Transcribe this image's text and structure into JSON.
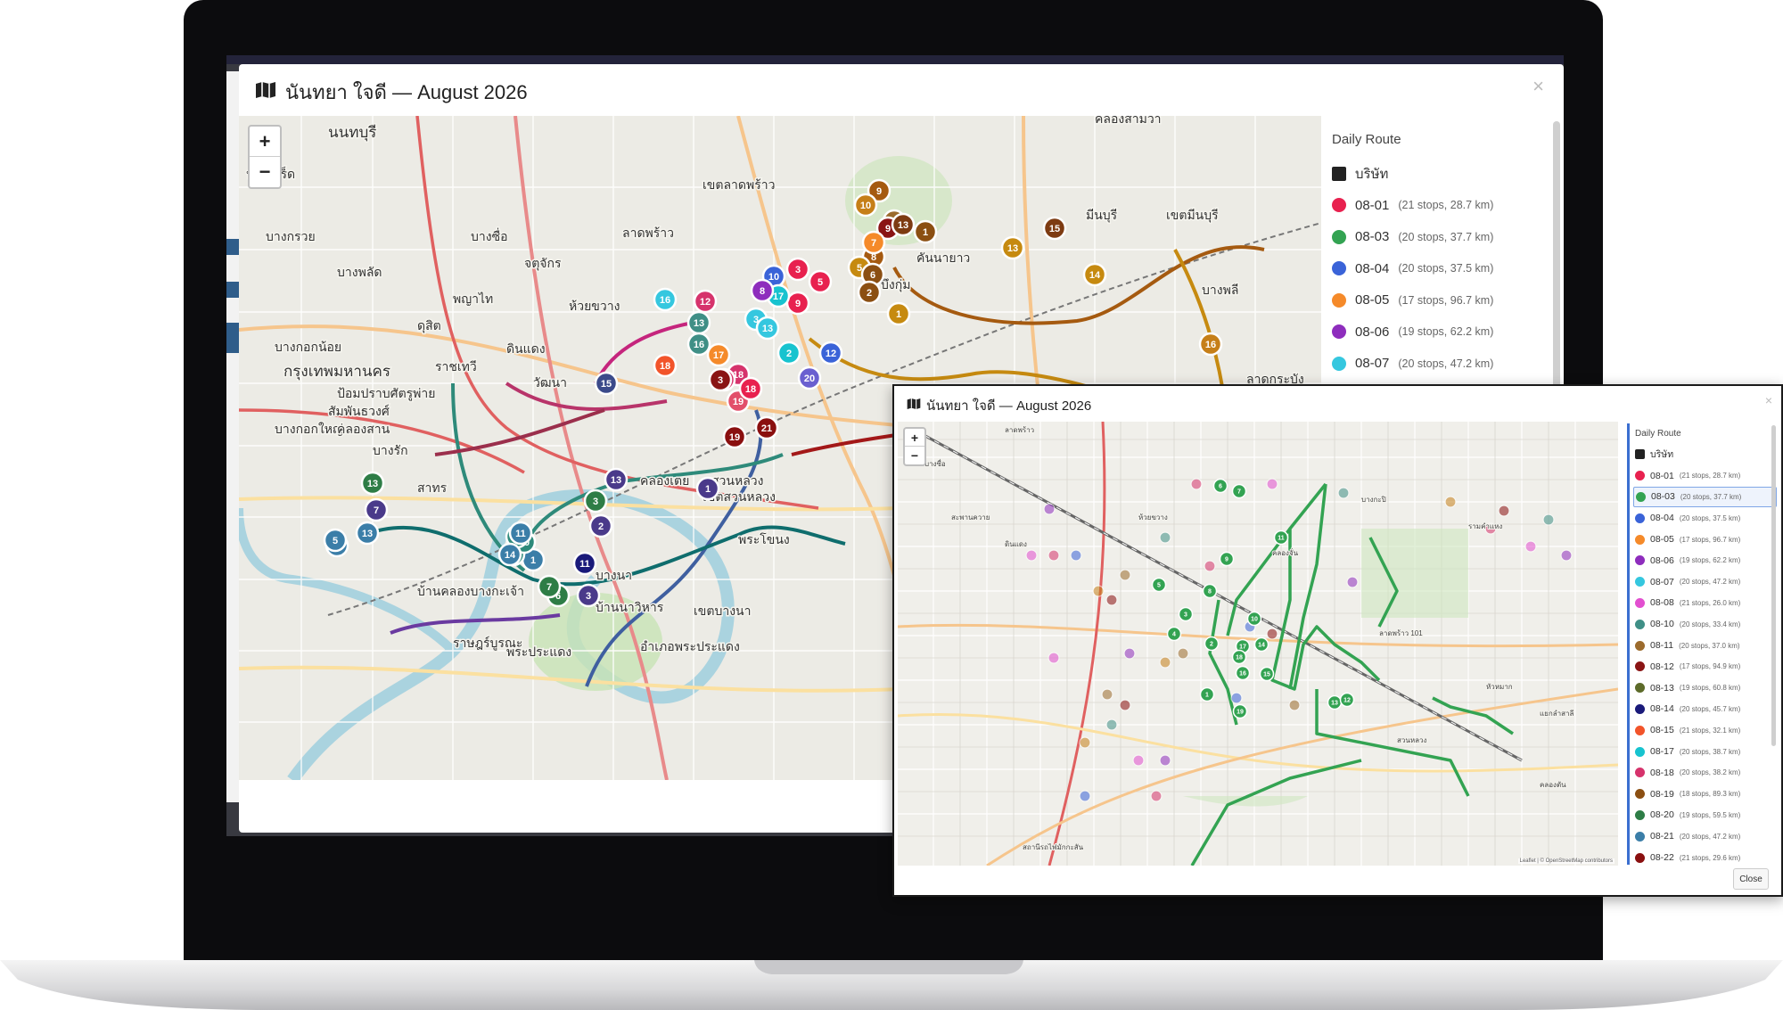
{
  "main_window": {
    "title": "นันทยา ใจดี — August 2026",
    "close_glyph": "×",
    "zoom_in": "+",
    "zoom_out": "−",
    "legend_title": "Daily Route",
    "legend": [
      {
        "label": "บริษัท",
        "meta": "",
        "color": "#222222",
        "square": true
      },
      {
        "label": "08-01",
        "meta": "(21 stops, 28.7 km)",
        "color": "#e8214f"
      },
      {
        "label": "08-03",
        "meta": "(20 stops, 37.7 km)",
        "color": "#33a352"
      },
      {
        "label": "08-04",
        "meta": "(20 stops, 37.5 km)",
        "color": "#3a63d8"
      },
      {
        "label": "08-05",
        "meta": "(17 stops, 96.7 km)",
        "color": "#f58a2a"
      },
      {
        "label": "08-06",
        "meta": "(19 stops, 62.2 km)",
        "color": "#8e2dbd"
      },
      {
        "label": "08-07",
        "meta": "(20 stops, 47.2 km)",
        "color": "#35c7df"
      }
    ],
    "map_labels": [
      "นนทบุรี",
      "คลองสามวา",
      "ปากเกร็ด",
      "เขตลาดพร้าว",
      "ลาดพร้าว",
      "จตุจักร",
      "บางซื่อ",
      "บางพลัด",
      "พญาไท",
      "ห้วยขวาง",
      "บึงกุ่ม",
      "คันนายาว",
      "มีนบุรี",
      "เขตมีนบุรี",
      "ดุสิต",
      "ดินแดง",
      "บางกอกน้อย",
      "กรุงเทพมหานคร",
      "ราชเทวี",
      "ป้อมปราบศัตรูพ่าย",
      "สัมพันธวงศ์",
      "บางกอกใหญ่",
      "คลองสาน",
      "บางรัก",
      "สาทร",
      "วัฒนา",
      "คลองเตย",
      "สวนหลวง",
      "เขตสวนหลวง",
      "พระโขนง",
      "บางนา",
      "บ้านนาวิหาร",
      "บ้านคลองบางกะเจ้า",
      "ราษฎร์บูรณะ",
      "พระประแดง",
      "อำเภอพระประแดง",
      "เขตบางนา",
      "บางกรวย",
      "บางพลี",
      "ลาดกระบัง"
    ]
  },
  "overlay_window": {
    "title": "นันทยา ใจดี — August 2026",
    "close_glyph": "×",
    "zoom_in": "+",
    "zoom_out": "−",
    "legend_title": "Daily Route",
    "selected_index": 2,
    "legend": [
      {
        "label": "บริษัท",
        "meta": "",
        "color": "#222222",
        "square": true
      },
      {
        "label": "08-01",
        "meta": "(21 stops, 28.7 km)",
        "color": "#e8214f"
      },
      {
        "label": "08-03",
        "meta": "(20 stops, 37.7 km)",
        "color": "#33a352"
      },
      {
        "label": "08-04",
        "meta": "(20 stops, 37.5 km)",
        "color": "#3a63d8"
      },
      {
        "label": "08-05",
        "meta": "(17 stops, 96.7 km)",
        "color": "#f58a2a"
      },
      {
        "label": "08-06",
        "meta": "(19 stops, 62.2 km)",
        "color": "#8e2dbd"
      },
      {
        "label": "08-07",
        "meta": "(20 stops, 47.2 km)",
        "color": "#35c7df"
      },
      {
        "label": "08-08",
        "meta": "(21 stops, 26.0 km)",
        "color": "#e24fd0"
      },
      {
        "label": "08-10",
        "meta": "(20 stops, 33.4 km)",
        "color": "#3f8f86"
      },
      {
        "label": "08-11",
        "meta": "(20 stops, 37.0 km)",
        "color": "#9c6b2d"
      },
      {
        "label": "08-12",
        "meta": "(17 stops, 94.9 km)",
        "color": "#8a1414"
      },
      {
        "label": "08-13",
        "meta": "(19 stops, 60.8 km)",
        "color": "#5d6b2a"
      },
      {
        "label": "08-14",
        "meta": "(20 stops, 45.7 km)",
        "color": "#1a1a7a"
      },
      {
        "label": "08-15",
        "meta": "(21 stops, 32.1 km)",
        "color": "#f2542a"
      },
      {
        "label": "08-17",
        "meta": "(20 stops, 38.7 km)",
        "color": "#17c3cf"
      },
      {
        "label": "08-18",
        "meta": "(20 stops, 38.2 km)",
        "color": "#d6336c"
      },
      {
        "label": "08-19",
        "meta": "(18 stops, 89.3 km)",
        "color": "#8b4f12"
      },
      {
        "label": "08-20",
        "meta": "(19 stops, 59.5 km)",
        "color": "#2e7d46"
      },
      {
        "label": "08-21",
        "meta": "(20 stops, 47.2 km)",
        "color": "#3b7ea8"
      },
      {
        "label": "08-22",
        "meta": "(21 stops, 29.6 km)",
        "color": "#8a0f0f"
      }
    ],
    "close_button": "Close",
    "attribution": "Leaflet | © OpenStreetMap contributors",
    "map_labels": [
      "ลาดพร้าว",
      "บางซื่อ",
      "สะพานควาย",
      "ดินแดง",
      "ห้วยขวาง",
      "คลองจั่น",
      "บางกะปิ",
      "ลาดพร้าว 101",
      "รามคำแหง",
      "หัวหมาก",
      "แยกลำสาลี",
      "คลองตัน",
      "สวนหลวง",
      "สถานีรถไฟมักกะสัน"
    ]
  },
  "pins": [
    {
      "n": "9",
      "c": "#a55a10"
    },
    {
      "n": "10",
      "c": "#c67f18"
    },
    {
      "n": "6",
      "c": "#9c6b2d"
    },
    {
      "n": "9",
      "c": "#8a1414"
    },
    {
      "n": "13",
      "c": "#7d3b12"
    },
    {
      "n": "8",
      "c": "#a55a10"
    },
    {
      "n": "7",
      "c": "#f58a2a"
    },
    {
      "n": "5",
      "c": "#c68a10"
    },
    {
      "n": "6",
      "c": "#8b4f12"
    },
    {
      "n": "2",
      "c": "#8b4f12"
    },
    {
      "n": "1",
      "c": "#8b4f12"
    },
    {
      "n": "1",
      "c": "#c68a10"
    },
    {
      "n": "15",
      "c": "#7d3b12"
    },
    {
      "n": "13",
      "c": "#c68a10"
    },
    {
      "n": "14",
      "c": "#c68a10"
    },
    {
      "n": "16",
      "c": "#c67f18"
    },
    {
      "n": "10",
      "c": "#3a63d8"
    },
    {
      "n": "3",
      "c": "#e8214f"
    },
    {
      "n": "5",
      "c": "#e8214f"
    },
    {
      "n": "9",
      "c": "#e8214f"
    },
    {
      "n": "17",
      "c": "#17c3cf"
    },
    {
      "n": "8",
      "c": "#8e2dbd"
    },
    {
      "n": "16",
      "c": "#35c7df"
    },
    {
      "n": "12",
      "c": "#d6336c"
    },
    {
      "n": "13",
      "c": "#3f8f86"
    },
    {
      "n": "3",
      "c": "#35c7df"
    },
    {
      "n": "13",
      "c": "#35c7df"
    },
    {
      "n": "16",
      "c": "#3f8f86"
    },
    {
      "n": "17",
      "c": "#f58a2a"
    },
    {
      "n": "18",
      "c": "#d6336c"
    },
    {
      "n": "16",
      "c": "#d6336c"
    },
    {
      "n": "3",
      "c": "#8a1414"
    },
    {
      "n": "19",
      "c": "#e24f6a"
    },
    {
      "n": "18",
      "c": "#e8214f"
    },
    {
      "n": "19",
      "c": "#8a0f0f"
    },
    {
      "n": "21",
      "c": "#8a0f0f"
    },
    {
      "n": "2",
      "c": "#17c3cf"
    },
    {
      "n": "12",
      "c": "#3a63d8"
    },
    {
      "n": "20",
      "c": "#6a5fd0"
    },
    {
      "n": "18",
      "c": "#f2542a"
    },
    {
      "n": "15",
      "c": "#3b4a8a"
    },
    {
      "n": "1",
      "c": "#4a3a8a"
    },
    {
      "n": "13",
      "c": "#4a3a8a"
    },
    {
      "n": "3",
      "c": "#2e7d46"
    },
    {
      "n": "2",
      "c": "#4a3a8a"
    },
    {
      "n": "11",
      "c": "#1a1a7a"
    },
    {
      "n": "3",
      "c": "#4a3a8a"
    },
    {
      "n": "6",
      "c": "#2e7d46"
    },
    {
      "n": "7",
      "c": "#2e7d46"
    },
    {
      "n": "1",
      "c": "#3b7ea8"
    },
    {
      "n": "2",
      "c": "#2e8a7a"
    },
    {
      "n": "20",
      "c": "#2e8a7a"
    },
    {
      "n": "17",
      "c": "#2e8a7a"
    },
    {
      "n": "3",
      "c": "#3b7ea8"
    },
    {
      "n": "5",
      "c": "#3b7ea8"
    },
    {
      "n": "13",
      "c": "#3b7ea8"
    },
    {
      "n": "7",
      "c": "#4a3a8a"
    },
    {
      "n": "13",
      "c": "#2e7d46"
    },
    {
      "n": "14",
      "c": "#3b7ea8"
    },
    {
      "n": "11",
      "c": "#3b7ea8"
    }
  ],
  "pins2": [
    {
      "n": "6",
      "c": "#33a352"
    },
    {
      "n": "7",
      "c": "#33a352"
    },
    {
      "n": "11",
      "c": "#33a352"
    },
    {
      "n": "9",
      "c": "#33a352"
    },
    {
      "n": "5",
      "c": "#33a352"
    },
    {
      "n": "8",
      "c": "#33a352"
    },
    {
      "n": "3",
      "c": "#33a352"
    },
    {
      "n": "4",
      "c": "#33a352"
    },
    {
      "n": "2",
      "c": "#33a352"
    },
    {
      "n": "10",
      "c": "#33a352"
    },
    {
      "n": "17",
      "c": "#33a352"
    },
    {
      "n": "14",
      "c": "#33a352"
    },
    {
      "n": "18",
      "c": "#33a352"
    },
    {
      "n": "15",
      "c": "#33a352"
    },
    {
      "n": "1",
      "c": "#33a352"
    },
    {
      "n": "16",
      "c": "#33a352"
    },
    {
      "n": "19",
      "c": "#33a352"
    },
    {
      "n": "13",
      "c": "#33a352"
    },
    {
      "n": "12",
      "c": "#33a352"
    }
  ]
}
